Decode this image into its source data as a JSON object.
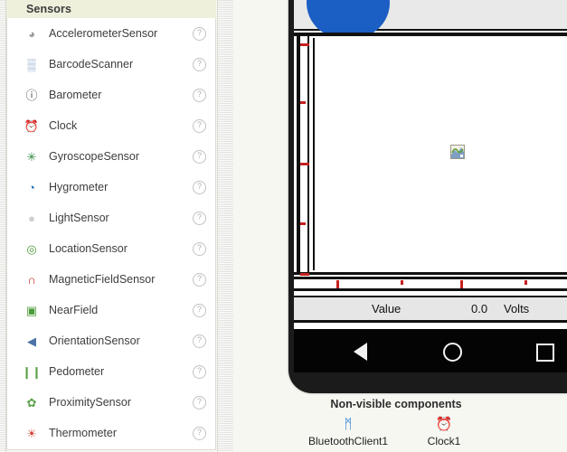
{
  "palette": {
    "header_title": "Sensors",
    "help_glyph": "?",
    "components": [
      {
        "label": "AccelerometerSensor",
        "icon": "accelerometer-icon",
        "glyph": "◕",
        "color": "#9a9a9a"
      },
      {
        "label": "BarcodeScanner",
        "icon": "barcode-scanner-icon",
        "glyph": "▒",
        "color": "#7b9ac4"
      },
      {
        "label": "Barometer",
        "icon": "barometer-icon",
        "glyph": "ⓘ",
        "color": "#444444"
      },
      {
        "label": "Clock",
        "icon": "clock-icon",
        "glyph": "⏰",
        "color": "#d8a33a"
      },
      {
        "label": "GyroscopeSensor",
        "icon": "gyroscope-icon",
        "glyph": "✳",
        "color": "#2f8a3f"
      },
      {
        "label": "Hygrometer",
        "icon": "hygrometer-icon",
        "glyph": "◔",
        "color": "#1f6fb4"
      },
      {
        "label": "LightSensor",
        "icon": "light-sensor-icon",
        "glyph": "●",
        "color": "#cfcfcf"
      },
      {
        "label": "LocationSensor",
        "icon": "location-sensor-icon",
        "glyph": "◎",
        "color": "#4c9a3a"
      },
      {
        "label": "MagneticFieldSensor",
        "icon": "magnetic-field-icon",
        "glyph": "∩",
        "color": "#c32b2b"
      },
      {
        "label": "NearField",
        "icon": "near-field-icon",
        "glyph": "▣",
        "color": "#4c9a3a"
      },
      {
        "label": "OrientationSensor",
        "icon": "orientation-sensor-icon",
        "glyph": "◀",
        "color": "#4a72a8"
      },
      {
        "label": "Pedometer",
        "icon": "pedometer-icon",
        "glyph": "❙❙",
        "color": "#5aa24a"
      },
      {
        "label": "ProximitySensor",
        "icon": "proximity-sensor-icon",
        "glyph": "✿",
        "color": "#5aa24a"
      },
      {
        "label": "Thermometer",
        "icon": "thermometer-icon",
        "glyph": "☀",
        "color": "#d4453a"
      }
    ]
  },
  "viewer": {
    "blue_button_label": "",
    "canvas_image_icon": "image-placeholder-icon",
    "value_bar": {
      "label": "Value",
      "number": "0.0",
      "unit": "Volts"
    },
    "vertical_ticks": [
      8,
      72,
      140,
      206,
      262
    ],
    "horizontal_ticks": [
      25,
      96,
      162,
      233
    ],
    "navbar": {
      "back": "back-triangle-icon",
      "home": "home-circle-icon",
      "recent": "recent-square-icon"
    }
  },
  "non_visible": {
    "title": "Non-visible components",
    "items": [
      {
        "name": "BluetoothClient1",
        "icon": "bluetooth-icon",
        "glyph": "ᛗ",
        "color": "#2a7fd4"
      },
      {
        "name": "Clock1",
        "icon": "clock-icon",
        "glyph": "⏰",
        "color": "#d8a33a"
      }
    ]
  },
  "colors": {
    "palette_header_bg": "#eef0dc",
    "app_bg": "#f7f7f2",
    "accent_blue": "#1c5fc4",
    "tick_red": "#c62020"
  }
}
